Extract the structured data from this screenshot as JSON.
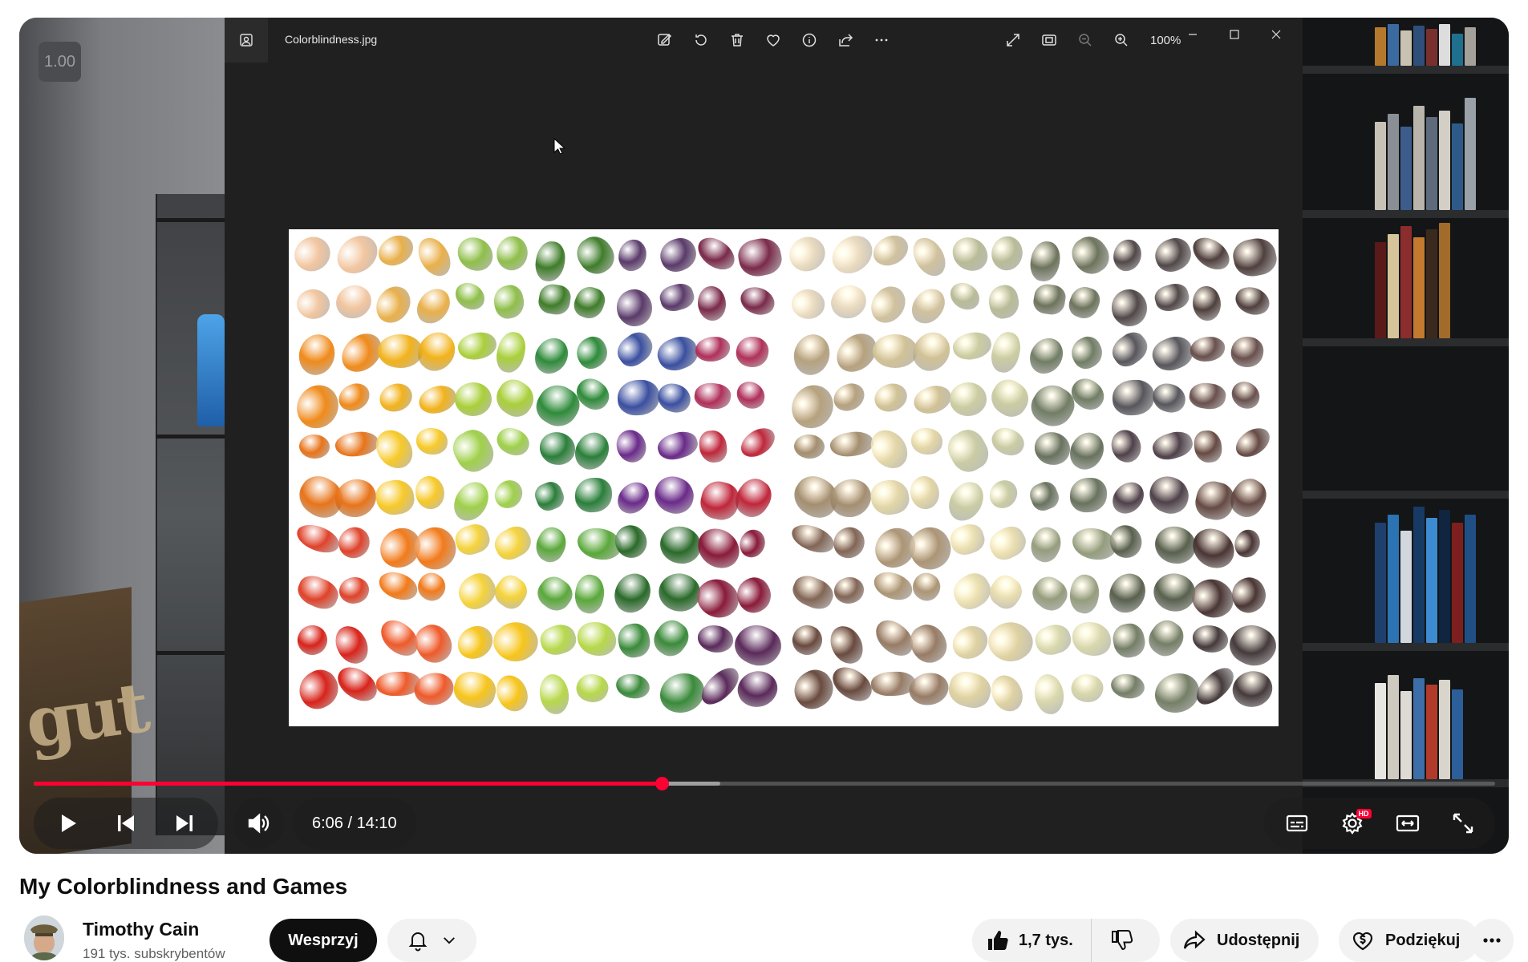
{
  "player": {
    "zoom_badge": "1.00",
    "time_current": "6:06",
    "time_separator": "/",
    "time_total": "14:10",
    "progress_fraction": 0.43,
    "buffered_fraction": 0.47,
    "hd_badge": "HD"
  },
  "photos_window": {
    "filename": "Colorblindness.jpg",
    "zoom_level": "100%"
  },
  "video": {
    "title": "My Colorblindness and Games"
  },
  "channel": {
    "name": "Timothy Cain",
    "subscribers": "191 tys. subskrybentów"
  },
  "actions": {
    "support_label": "Wesprzyj",
    "like_count": "1,7 tys.",
    "share_label": "Udostępnij",
    "thanks_label": "Podziękuj"
  },
  "colors": {
    "accent": "#ff0033",
    "text_primary": "#0f0f0f",
    "text_secondary": "#606060",
    "button_bg": "#f2f2f2"
  },
  "icons": [
    "play-icon",
    "previous-icon",
    "next-icon",
    "volume-icon",
    "subtitles-icon",
    "settings-icon",
    "theater-mode-icon",
    "fullscreen-icon",
    "bell-icon",
    "chevron-down-icon",
    "thumbs-up-icon",
    "thumbs-down-icon",
    "share-icon",
    "thanks-icon",
    "more-icon"
  ]
}
